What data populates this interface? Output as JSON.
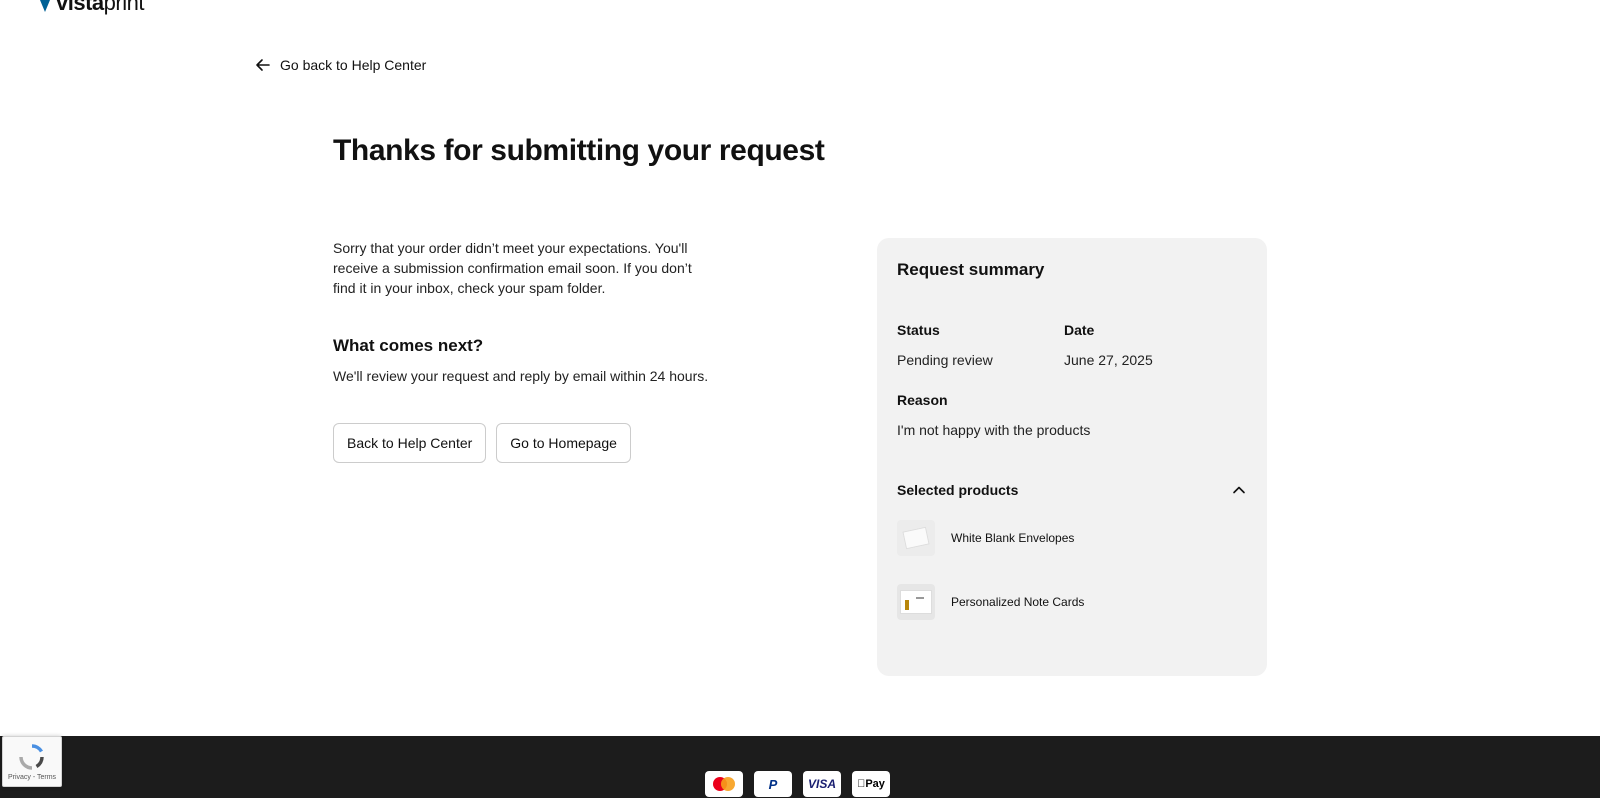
{
  "brand": {
    "logo_main": "vista",
    "logo_rest": "print",
    "logo_mark_color": "#006196"
  },
  "nav": {
    "back_link": "Go back to Help Center"
  },
  "page": {
    "title": "Thanks for submitting your request",
    "intro": "Sorry that your order didn’t meet your expectations. You'll receive a submission confirmation email soon. If you don’t find it in your inbox, check your spam folder.",
    "next_heading": "What comes next?",
    "next_text": "We'll review your request and reply by email within 24 hours."
  },
  "actions": {
    "back_to_help": "Back to Help Center",
    "go_home": "Go to Homepage"
  },
  "summary": {
    "title": "Request summary",
    "status_label": "Status",
    "status_value": "Pending review",
    "date_label": "Date",
    "date_value": "June 27, 2025",
    "reason_label": "Reason",
    "reason_value": "I'm not happy with the products",
    "selected_label": "Selected products",
    "selected_expanded": true,
    "products": [
      {
        "name": "White Blank Envelopes",
        "icon": "envelope-thumbnail"
      },
      {
        "name": "Personalized Note Cards",
        "icon": "note-card-thumbnail"
      }
    ]
  },
  "footer": {
    "background": "#1c1c1c",
    "payment_methods": [
      "Mastercard",
      "PayPal",
      "VISA",
      "Apple Pay"
    ],
    "paypal_label": "P",
    "visa_label": "VISA",
    "applepay_label": "Pay"
  },
  "recaptcha": {
    "text": "Privacy - Terms"
  }
}
